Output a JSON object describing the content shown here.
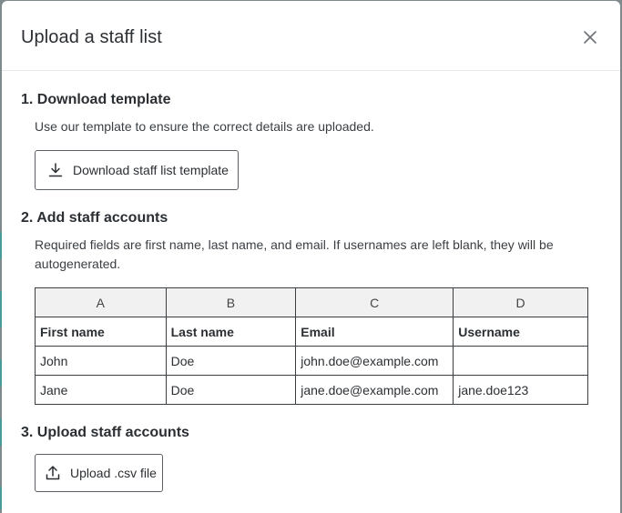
{
  "modal": {
    "title": "Upload a staff list",
    "close_icon": "close-icon"
  },
  "step1": {
    "title": "1. Download template",
    "description": "Use our template to ensure the correct details are uploaded.",
    "button_label": "Download staff list template",
    "button_icon": "download-icon"
  },
  "step2": {
    "title": "2. Add staff accounts",
    "description": "Required fields are first name, last name, and email. If usernames are left blank, they will be autogenerated.",
    "table": {
      "column_letters": [
        "A",
        "B",
        "C",
        "D"
      ],
      "headers": [
        "First name",
        "Last name",
        "Email",
        "Username"
      ],
      "rows": [
        [
          "John",
          "Doe",
          "john.doe@example.com",
          ""
        ],
        [
          "Jane",
          "Doe",
          "jane.doe@example.com",
          "jane.doe123"
        ]
      ]
    }
  },
  "step3": {
    "title": "3. Upload staff accounts",
    "button_label": "Upload .csv file",
    "button_icon": "upload-icon"
  },
  "colors": {
    "backdrop": "#7f8a8c",
    "modal_bg": "#ffffff",
    "text": "#2b2f33",
    "letter_row_bg": "#f1f1f1"
  }
}
